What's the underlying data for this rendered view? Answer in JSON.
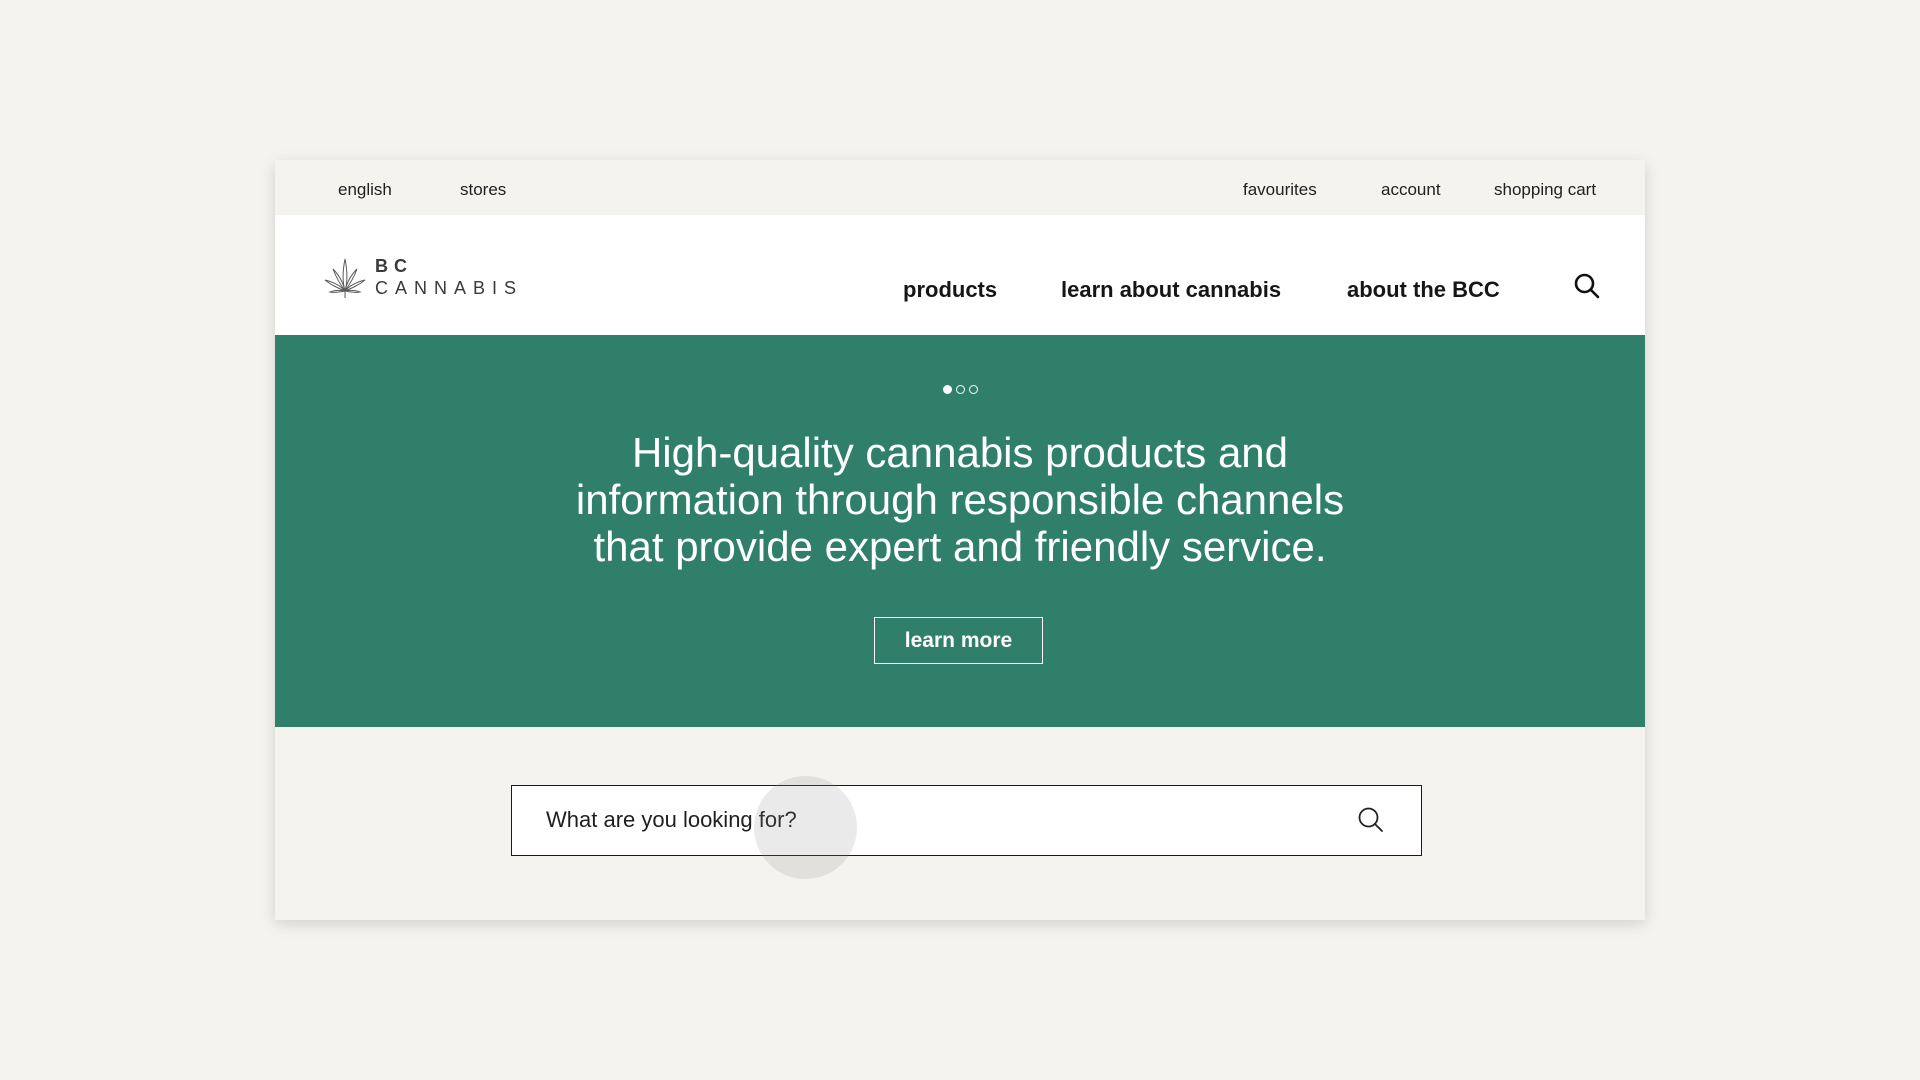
{
  "utility_bar": {
    "left": [
      "english",
      "stores"
    ],
    "right": [
      "favourites",
      "account",
      "shopping cart"
    ]
  },
  "logo": {
    "icon": "cannabis-leaf-icon",
    "line1": "BC",
    "line2": "CANNABIS"
  },
  "main_nav": [
    "products",
    "learn about cannabis",
    "about the BCC"
  ],
  "hero": {
    "slides_total": 3,
    "active_slide": 1,
    "headline_lines": [
      "High-quality cannabis products and",
      "information through responsible channels",
      "that provide expert and friendly service."
    ],
    "cta_label": "learn more"
  },
  "search": {
    "placeholder": "What are you looking for?",
    "value": ""
  },
  "colors": {
    "page_bg": "#f5f3ee",
    "hero_green": "#307f6a",
    "header_bg": "#ffffff",
    "text_dark": "#161616"
  }
}
